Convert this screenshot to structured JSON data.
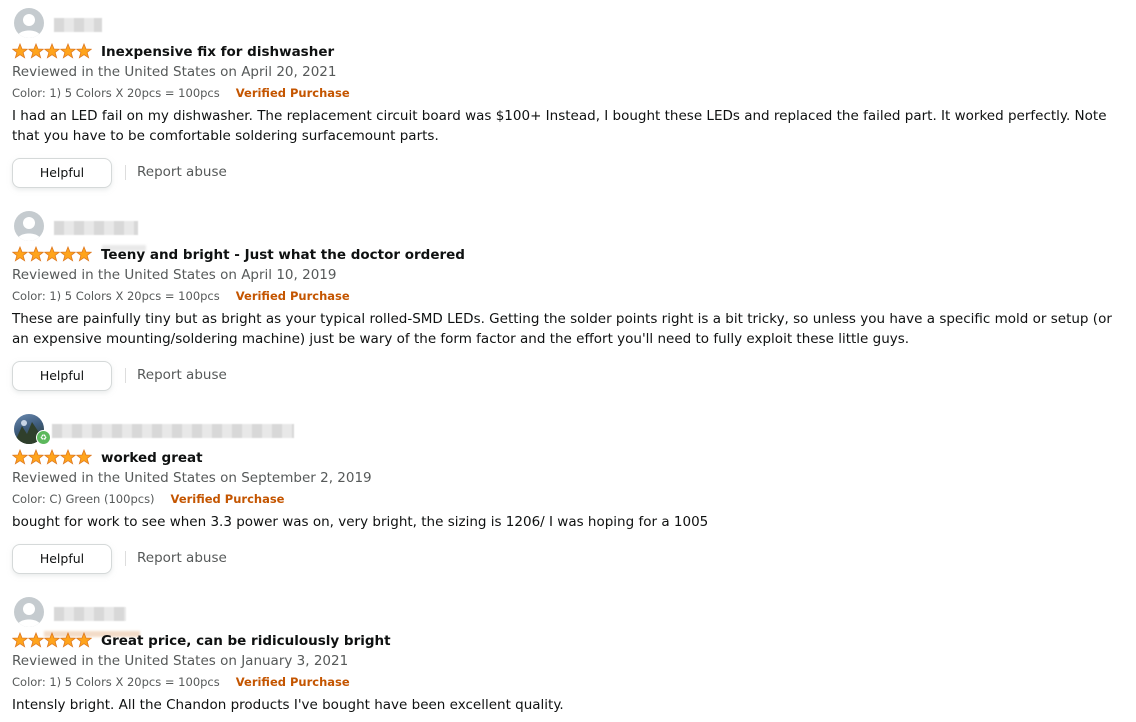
{
  "colors": {
    "star_fill": "#ffa41c",
    "star_stroke": "#de7921",
    "verified": "#c45500",
    "muted_text": "#565959",
    "body_text": "#0f1111"
  },
  "reviews": [
    {
      "avatar_icon": "default-user-avatar-icon",
      "rating": 5,
      "title": "Inexpensive fix for dishwasher",
      "date": "Reviewed in the United States on April 20, 2021",
      "variant": "Color: 1) 5 Colors X 20pcs = 100pcs",
      "verified": "Verified Purchase",
      "body": "I had an LED fail on my dishwasher. The replacement circuit board was $100+ Instead, I bought these LEDs and replaced the failed part. It worked perfectly. Note that you have to be comfortable soldering surfacemount parts.",
      "helpful_label": "Helpful",
      "report_label": "Report abuse"
    },
    {
      "avatar_icon": "default-user-avatar-icon",
      "rating": 5,
      "title": "Teeny and bright - Just what the doctor ordered",
      "date": "Reviewed in the United States on April 10, 2019",
      "variant": "Color: 1) 5 Colors X 20pcs = 100pcs",
      "verified": "Verified Purchase",
      "body": "These are painfully tiny but as bright as your typical rolled-SMD LEDs. Getting the solder points right is a bit tricky, so unless you have a specific mold or setup (or an expensive mounting/soldering machine) just be wary of the form factor and the effort you'll need to fully exploit these little guys.",
      "helpful_label": "Helpful",
      "report_label": "Report abuse"
    },
    {
      "avatar_icon": "user-photo-avatar-icon",
      "rating": 5,
      "title": "worked great",
      "date": "Reviewed in the United States on September 2, 2019",
      "variant": "Color: C) Green (100pcs)",
      "verified": "Verified Purchase",
      "body": "bought for work to see when 3.3 power was on, very bright, the sizing is 1206/ I was hoping for a 1005",
      "helpful_label": "Helpful",
      "report_label": "Report abuse"
    },
    {
      "avatar_icon": "default-user-avatar-icon",
      "rating": 5,
      "title": "Great price, can be ridiculously bright",
      "date": "Reviewed in the United States on January 3, 2021",
      "variant": "Color: 1) 5 Colors X 20pcs = 100pcs",
      "verified": "Verified Purchase",
      "body": "Intensly bright. All the Chandon products I've bought have been excellent quality."
    }
  ]
}
